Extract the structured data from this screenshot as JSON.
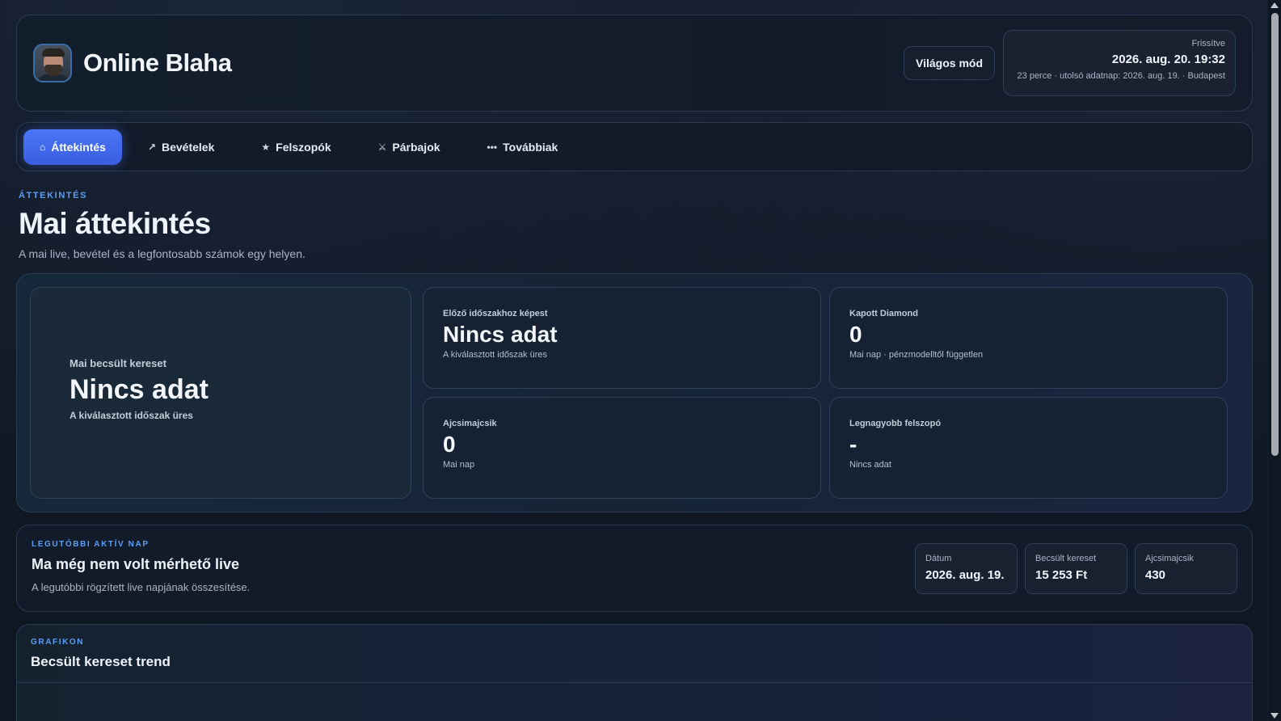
{
  "header": {
    "brand": "Online Blaha",
    "mode_button": "Világos mód",
    "refresh_label": "Frissítve",
    "refresh_time": "2026. aug. 20. 19:32",
    "refresh_sub": "23 perce · utolsó adatnap: 2026. aug. 19. · Budapest"
  },
  "nav": {
    "tabs": [
      {
        "label": "Áttekintés",
        "icon": "home-icon",
        "glyph": "⌂",
        "active": true
      },
      {
        "label": "Bevételek",
        "icon": "trend-arrow-icon",
        "glyph": "↗",
        "active": false
      },
      {
        "label": "Felszopók",
        "icon": "star-icon",
        "glyph": "★",
        "active": false
      },
      {
        "label": "Párbajok",
        "icon": "crossed-swords-icon",
        "glyph": "⚔",
        "active": false
      },
      {
        "label": "Továbbiak",
        "icon": "more-dots-icon",
        "glyph": "•••",
        "active": false
      }
    ]
  },
  "overview": {
    "eyebrow": "ÁTTEKINTÉS",
    "title": "Mai áttekintés",
    "subtitle": "A mai live, bevétel és a legfontosabb számok egy helyen."
  },
  "stats": {
    "main": {
      "label": "Mai becsült kereset",
      "value": "Nincs adat",
      "sub": "A kiválasztott időszak üres"
    },
    "prev": {
      "label": "Előző időszakhoz képest",
      "value": "Nincs adat",
      "sub": "A kiválasztott időszak üres"
    },
    "diamond": {
      "label": "Kapott Diamond",
      "value": "0",
      "sub": "Mai nap · pénzmodelltől független"
    },
    "ajcsi": {
      "label": "Ajcsimajcsik",
      "value": "0",
      "sub": "Mai nap"
    },
    "top": {
      "label": "Legnagyobb felszopó",
      "value": "-",
      "sub": "Nincs adat"
    }
  },
  "latest": {
    "eyebrow": "LEGUTÓBBI AKTÍV NAP",
    "title": "Ma még nem volt mérhető live",
    "desc": "A legutóbbi rögzített live napjának összesítése.",
    "minis": [
      {
        "label": "Dátum",
        "value": "2026. aug. 19."
      },
      {
        "label": "Becsült kereset",
        "value": "15 253 Ft"
      },
      {
        "label": "Ajcsimajcsik",
        "value": "430"
      }
    ]
  },
  "chart": {
    "eyebrow": "GRAFIKON",
    "title": "Becsült kereset trend"
  },
  "colors": {
    "accent": "#4a76f6",
    "eyebrow": "#5b9ef5",
    "background": "#0f1723"
  }
}
